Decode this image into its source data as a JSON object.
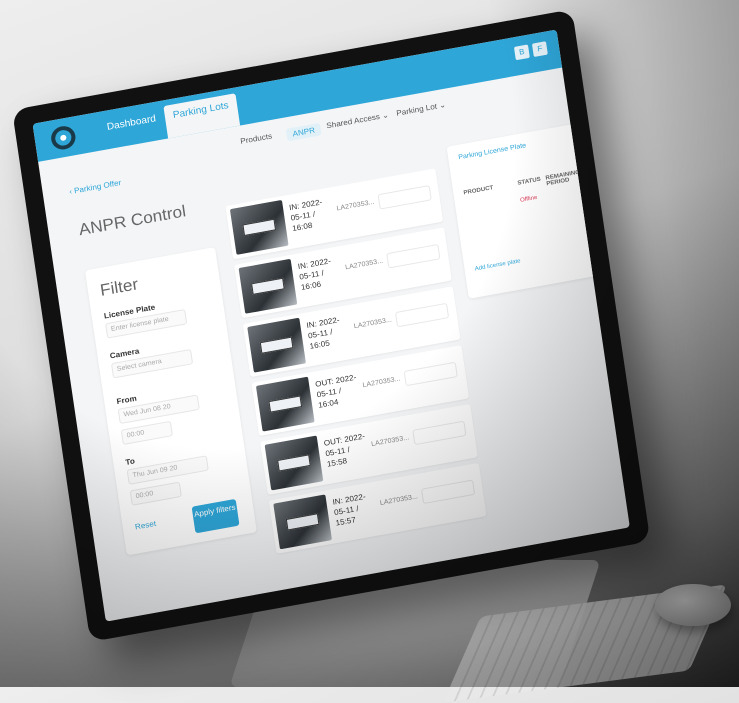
{
  "nav": {
    "dashboard": "Dashboard",
    "parking_lots": "Parking Lots",
    "avatars": [
      "B",
      "F"
    ]
  },
  "subnav": {
    "products": "Products",
    "anpr": "ANPR",
    "shared_access": "Shared Access ⌄",
    "parking_lot": "Parking Lot ⌄"
  },
  "page": {
    "back": "Parking Offer",
    "title": "ANPR Control"
  },
  "filter": {
    "title": "Filter",
    "license_plate_label": "License Plate",
    "license_plate_placeholder": "Enter license plate",
    "camera_label": "Camera",
    "camera_placeholder": "Select camera",
    "from_label": "From",
    "from_date": "Wed Jun 08 20",
    "from_time": "00:00",
    "to_label": "To",
    "to_date": "Thu Jun 09 20",
    "to_time": "00:00",
    "reset": "Reset",
    "apply": "Apply filters"
  },
  "events": [
    {
      "time": "IN: 2022-05-11 / 16:08",
      "id": "LA270353..."
    },
    {
      "time": "IN: 2022-05-11 / 16:06",
      "id": "LA270353..."
    },
    {
      "time": "IN: 2022-05-11 / 16:05",
      "id": "LA270353..."
    },
    {
      "time": "OUT: 2022-05-11 / 16:04",
      "id": "LA270353..."
    },
    {
      "time": "OUT: 2022-05-11 / 15:58",
      "id": "LA270353..."
    },
    {
      "time": "IN: 2022-05-11 / 15:57",
      "id": "LA270353..."
    }
  ],
  "right_panel": {
    "header": "Parking License Plate",
    "col_product": "PRODUCT",
    "col_status": "STATUS",
    "col_remaining": "REMAINING PERIOD",
    "row_status": "Offline",
    "link": "Add license plate"
  },
  "colors": {
    "accent": "#2ea6d8",
    "alert": "#d93a56"
  }
}
